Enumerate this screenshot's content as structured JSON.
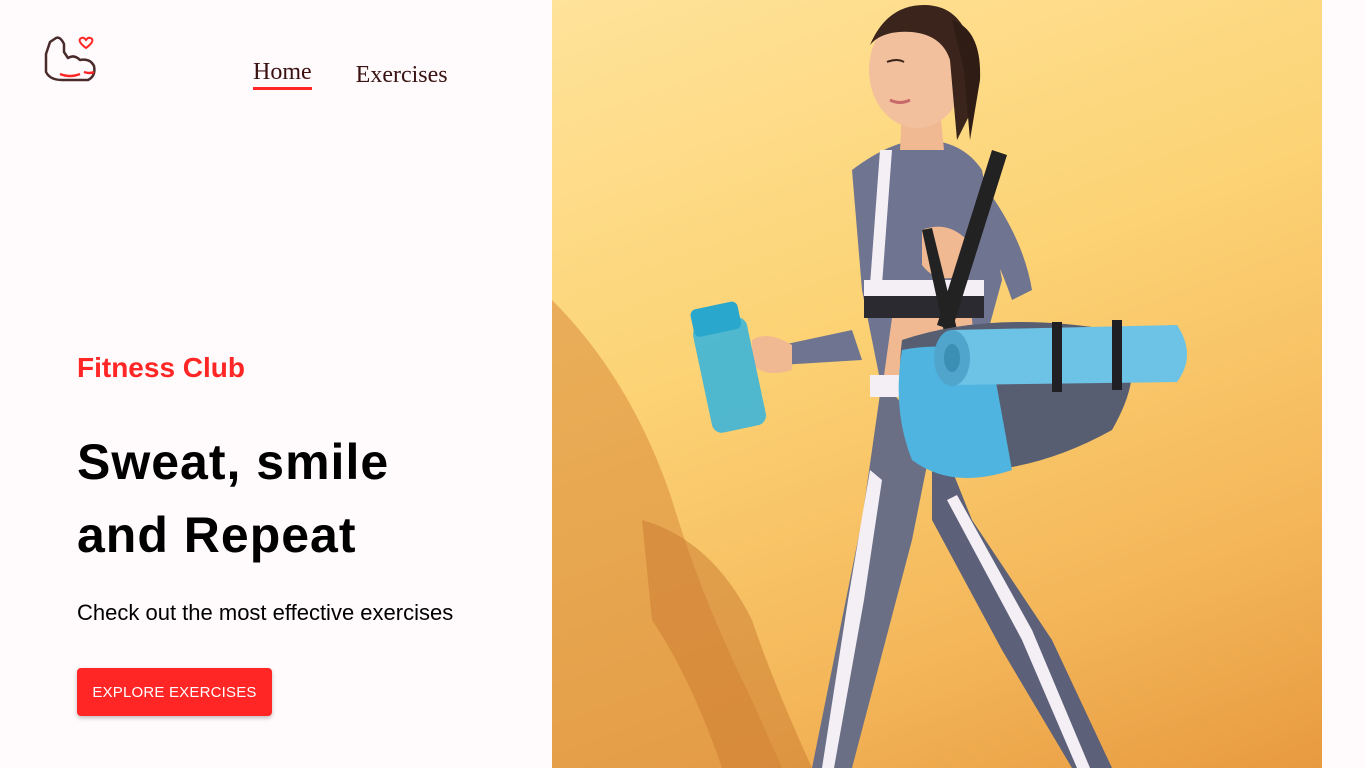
{
  "nav": {
    "items": [
      {
        "label": "Home",
        "active": true
      },
      {
        "label": "Exercises",
        "active": false
      }
    ]
  },
  "hero": {
    "eyebrow": "Fitness Club",
    "title_line1": "Sweat, smile",
    "title_line2": "and Repeat",
    "subtitle": "Check out the most effective exercises",
    "cta_label": "EXPLORE EXERCISES"
  },
  "banner": {
    "icon": "woman-with-yoga-mat-illustration"
  },
  "colors": {
    "accent": "#ff2625",
    "background": "#fffafb",
    "banner_bg": "#fcd375"
  }
}
